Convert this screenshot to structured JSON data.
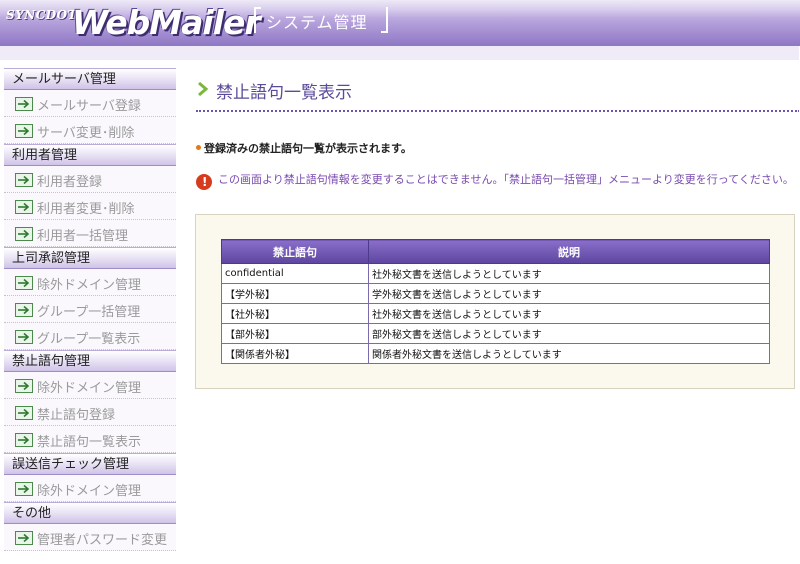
{
  "header": {
    "brand": "SYNCDOT",
    "logo": "WebMailer",
    "system_title": "システム管理"
  },
  "sidebar": {
    "categories": [
      {
        "label": "メールサーバ管理",
        "items": [
          {
            "label": "メールサーバ登録"
          },
          {
            "label": "サーバ変更･削除"
          }
        ]
      },
      {
        "label": "利用者管理",
        "items": [
          {
            "label": "利用者登録"
          },
          {
            "label": "利用者変更･削除"
          },
          {
            "label": "利用者一括管理"
          }
        ]
      },
      {
        "label": "上司承認管理",
        "items": [
          {
            "label": "除外ドメイン管理"
          },
          {
            "label": "グループ一括管理"
          },
          {
            "label": "グループ一覧表示"
          }
        ]
      },
      {
        "label": "禁止語句管理",
        "items": [
          {
            "label": "除外ドメイン管理"
          },
          {
            "label": "禁止語句登録"
          },
          {
            "label": "禁止語句一覧表示"
          }
        ]
      },
      {
        "label": "誤送信チェック管理",
        "items": [
          {
            "label": "除外ドメイン管理"
          }
        ]
      },
      {
        "label": "その他",
        "items": [
          {
            "label": "管理者パスワード変更"
          }
        ]
      }
    ],
    "icon": "arrow-right-icon"
  },
  "main": {
    "title": "禁止語句一覧表示",
    "description": "登録済みの禁止語句一覧が表示されます。",
    "warning": "この画面より禁止語句情報を変更することはできません。「禁止語句一括管理」メニューより変更を行ってください。",
    "table": {
      "headers": [
        "禁止語句",
        "説明"
      ],
      "rows": [
        [
          "confidential",
          "社外秘文書を送信しようとしています"
        ],
        [
          "【学外秘】",
          "学外秘文書を送信しようとしています"
        ],
        [
          "【社外秘】",
          "社外秘文書を送信しようとしています"
        ],
        [
          "【部外秘】",
          "部外秘文書を送信しようとしています"
        ],
        [
          "【関係者外秘】",
          "関係者外秘文書を送信しようとしています"
        ]
      ]
    }
  },
  "colors": {
    "accent": "#5b4a9a",
    "header_bottom": "#8f77c4",
    "warning_text": "#7a4ab0",
    "warning_icon": "#d63b1e"
  }
}
